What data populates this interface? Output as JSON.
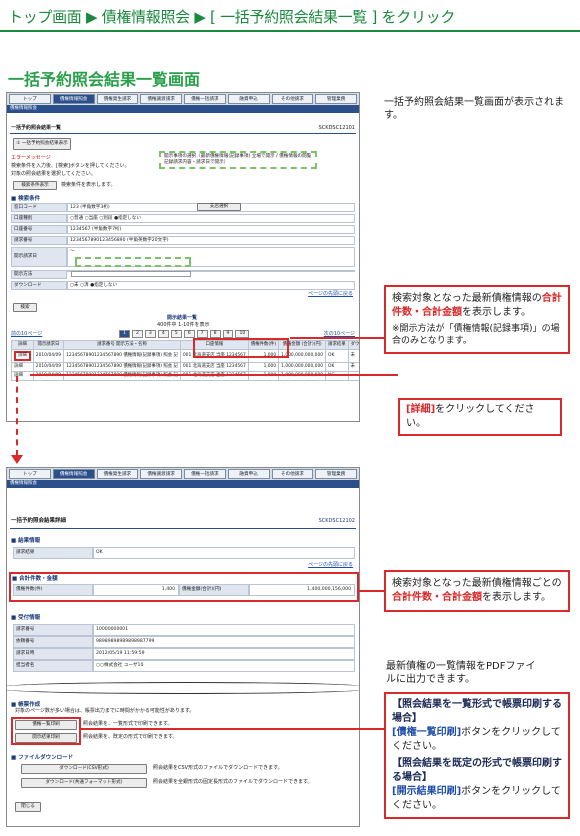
{
  "breadcrumb": "トップ画面 ▶ 債権情報照会 ▶ [ 一括予約照会結果一覧 ] をクリック",
  "heading": "一括予約照会結果一覧画面",
  "top_desc": "一括予約照会結果一覧画面が表示されます。",
  "callout1": {
    "pre": "検索対象となった最新債権情報の",
    "red": "合計件数・合計金額",
    "post": "を表示します。",
    "note": "※開示方法が「債権情報(記録事項)」の場合のみとなります。"
  },
  "callout2": {
    "red": "[詳細]",
    "post": "をクリックしてください。"
  },
  "callout3": {
    "pre": "検索対象となった最新債権情報ごとの",
    "red": "合計件数・合計金額",
    "post": "を表示します。"
  },
  "pdf_desc": "最新債権の一覧情報をPDFファイルに出力できます。",
  "callout4": {
    "h1": "【照会結果を一覧形式で帳票印刷する場合】",
    "b1": "[債権一覧印刷]",
    "t1": "ボタンをクリックしてください。",
    "h2": "【照会結果を既定の形式で帳票印刷する場合】",
    "b2": "[開示結果印刷]",
    "t2": "ボタンをクリックしてください。"
  },
  "shot1": {
    "nav": [
      "トップ",
      "債権情報照会",
      "債権発生請求",
      "債権譲渡請求",
      "債権一括請求",
      "融資申込",
      "その他請求",
      "管理業務"
    ],
    "sub": "債権情報照会",
    "title": "一括予約照会結果一覧",
    "code": "SCKDSC12101",
    "section_btn": "① 一括予約照会結果表示",
    "err_label": "エラーメッセージ",
    "err1": "検索条件を入力後、[検索]ボタンを押してください。",
    "err2": "対象の照会結果を選択してください。",
    "hint": "開示事項の選択（最新債権情報(記録事項) 立場で開示 / 債権情報の閲覧 記録請求内容・請求日で開示）",
    "btn_condition": "検索条件表示",
    "cond_note": "検索条件を表示します。",
    "sec_cond": "■ 検索条件",
    "rows": [
      {
        "label": "窓口コード",
        "value": "123  (半角数字3桁)"
      },
      {
        "label": "口座種別",
        "value": "○普通 ○当座 ○別段 ●指定しない"
      },
      {
        "label": "口座番号",
        "value": "1234567  (半角数字7桁)"
      },
      {
        "label": "請求番号",
        "value": "1234567890123456890  (半角英数字20文字)"
      },
      {
        "label": "開示請求日",
        "value": "              〜              "
      },
      {
        "label": "開示方法",
        "value": ""
      },
      {
        "label": "ダウンロード",
        "value": "○未 ○済 ●指定しない"
      }
    ],
    "btn_search_branch": "支店選択",
    "link_open": "ページの先頭に戻る",
    "btn_search": "検索",
    "result_title": "開示結果一覧",
    "result_count": "400件中 1-10件を表示",
    "pages": [
      "1",
      "2",
      "3",
      "4",
      "5",
      "6",
      "7",
      "8",
      "9",
      "10"
    ],
    "prev": "前の10ページ",
    "next": "次の10ページ",
    "headers": [
      "詳細",
      "開示請求日",
      "請求番号 開示方法・名称",
      "口座情報",
      "債権件数(件)",
      "債権金額 (合計)(円)",
      "請求結果",
      "ダウンロード"
    ],
    "table": [
      [
        "詳細",
        "2010/04/09",
        "12345678901234567890 債権情報(記録事項)  照会 記",
        "001 北海道支店 当座 1234567",
        "1,000",
        "1,000,000,000,000",
        "OK",
        "未"
      ],
      [
        "詳細",
        "2010/04/09",
        "12345678901234567890 債権情報(記録事項)  照会 記",
        "001 北海道支店 当座 1234567",
        "1,000",
        "1,000,000,000,000",
        "OK",
        "未"
      ],
      [
        "詳細",
        "2010/04/09",
        "12345678901234567890 債権情報(記録事項)  照会 記",
        "001 北海道支店 当座 1234567",
        "1,000",
        "1,000,000,000,000",
        "NG",
        "−"
      ]
    ]
  },
  "shot2": {
    "nav": [
      "トップ",
      "債権情報照会",
      "債権発生請求",
      "債権譲渡請求",
      "債権一括請求",
      "融資申込",
      "その他請求",
      "管理業務"
    ],
    "sub": "債権情報照会",
    "title": "一括予約照会結果詳細",
    "code": "SCKDSC12102",
    "sec_result": "■ 結果情報",
    "result_label": "請求結果",
    "result_value": "OK",
    "top_link": "ページの先頭に戻る",
    "sec_total": "■ 合計件数・金額",
    "count_label": "債権件数(件)",
    "count_value": "1,400",
    "amount_label": "債権金額(合計)(円)",
    "amount_value": "1,400,000,156,000",
    "sec_accept": "■ 受付情報",
    "accept": [
      {
        "label": "請求番号",
        "value": "10000000001"
      },
      {
        "label": "依頼番号",
        "value": "98989898989898987799"
      },
      {
        "label": "請求日時",
        "value": "2012/05/19 11:59:59"
      },
      {
        "label": "担当者名",
        "value": "○○株式会社 ユーザ10"
      }
    ],
    "sec_form": "■ 帳票作成",
    "form_note": "対象のページ数が多い場合は、帳票出力までに時間がかかる可能性があります。",
    "btn_list": "債権一覧印刷",
    "btn_list_note": "照会結果を、一覧形式で印刷できます。",
    "btn_result": "開示結果印刷",
    "btn_result_note": "照会結果を、既定の形式で印刷できます。",
    "sec_dl": "■ ファイルダウンロード",
    "dl1": "ダウンロード(CSV形式)",
    "dl1_note": "照会結果をCSV形式のファイルでダウンロードできます。",
    "dl2": "ダウンロード(共通フォーマット形式)",
    "dl2_note": "照会結果を全銀形式の固定長形式のファイルでダウンロードできます。",
    "btn_close": "閉じる"
  }
}
